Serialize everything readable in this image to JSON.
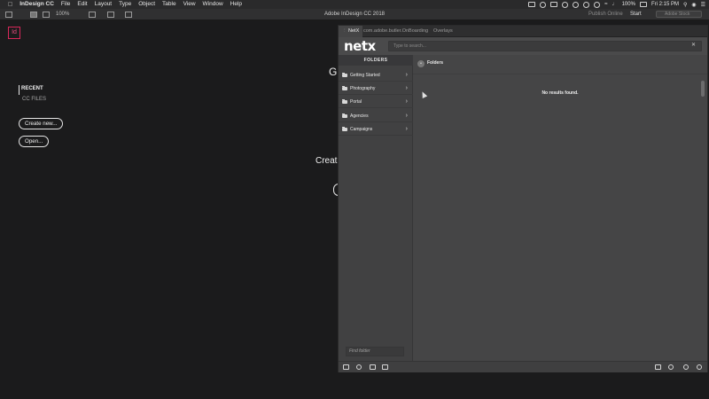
{
  "menubar": {
    "app_name": "InDesign CC",
    "menus": [
      "File",
      "Edit",
      "Layout",
      "Type",
      "Object",
      "Table",
      "View",
      "Window",
      "Help"
    ],
    "battery": "100%",
    "clock": "Fri 2:15 PM"
  },
  "appbar": {
    "window_title": "Adobe InDesign CC 2018",
    "zoom": "100%",
    "publish_online": "Publish Online",
    "start": "Start",
    "adobe_stock_placeholder": "Adobe Stock"
  },
  "start_screen": {
    "logo_text": "Id",
    "recent": "RECENT",
    "cc_files": "CC FILES",
    "create_new": "Create new...",
    "open": "Open...",
    "heading_fragment": "G",
    "create_fragment": "Create"
  },
  "netx_panel": {
    "tabs": [
      {
        "label": "NetX",
        "active": true
      },
      {
        "label": "com.adobe.butler.OnBoarding",
        "active": false
      },
      {
        "label": "Overlays",
        "active": false
      }
    ],
    "logo": "netx",
    "search_placeholder": "Type to search...",
    "sidebar": {
      "header": "FOLDERS",
      "folders": [
        {
          "label": "Getting Started"
        },
        {
          "label": "Photography"
        },
        {
          "label": "Portal"
        },
        {
          "label": "Agencies"
        },
        {
          "label": "Campaigns"
        }
      ],
      "find_folder_placeholder": "Find folder"
    },
    "breadcrumb": "Folders",
    "empty_message": "No results found."
  },
  "icons": {
    "search_clear": "close-icon",
    "folder": "folder-icon",
    "chevron": "chevron-right-icon"
  }
}
